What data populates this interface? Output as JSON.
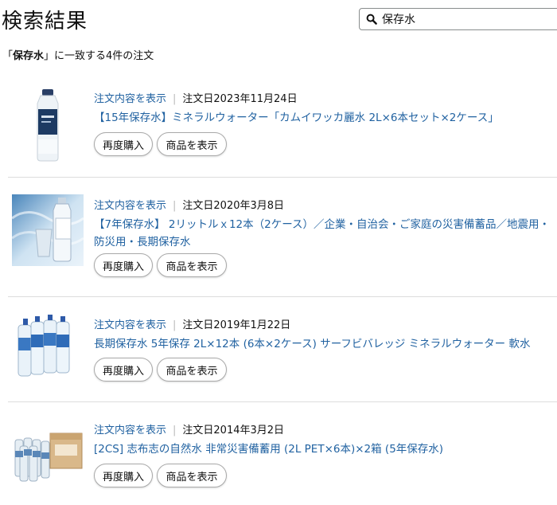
{
  "header": {
    "title": "検索結果"
  },
  "search": {
    "value": "保存水"
  },
  "summary": {
    "open_quote": "「",
    "keyword": "保存水",
    "rest": "」に一致する4件の注文"
  },
  "orders": [
    {
      "view_link": "注文内容を表示",
      "date": "注文日2023年11月24日",
      "product": "【15年保存水】ミネラルウォーター「カムイワッカ麗水 2L×6本セット×2ケース」",
      "buy_again": "再度購入",
      "view_item": "商品を表示"
    },
    {
      "view_link": "注文内容を表示",
      "date": "注文日2020年3月8日",
      "product": "【7年保存水】 2リットルｘ12本（2ケース）／企業・自治会・ご家庭の災害備蓄品／地震用・防災用・長期保存水",
      "buy_again": "再度購入",
      "view_item": "商品を表示"
    },
    {
      "view_link": "注文内容を表示",
      "date": "注文日2019年1月22日",
      "product": "長期保存水 5年保存 2L×12本 (6本×2ケース) サーフビバレッジ ミネラルウォーター 軟水",
      "buy_again": "再度購入",
      "view_item": "商品を表示"
    },
    {
      "view_link": "注文内容を表示",
      "date": "注文日2014年3月2日",
      "product": "[2CS] 志布志の自然水 非常災害備蓄用 (2L PET×6本)×2箱 (5年保存水)",
      "buy_again": "再度購入",
      "view_item": "商品を表示"
    }
  ],
  "colors": {
    "link": "#2162a1",
    "border": "#dddddd"
  }
}
